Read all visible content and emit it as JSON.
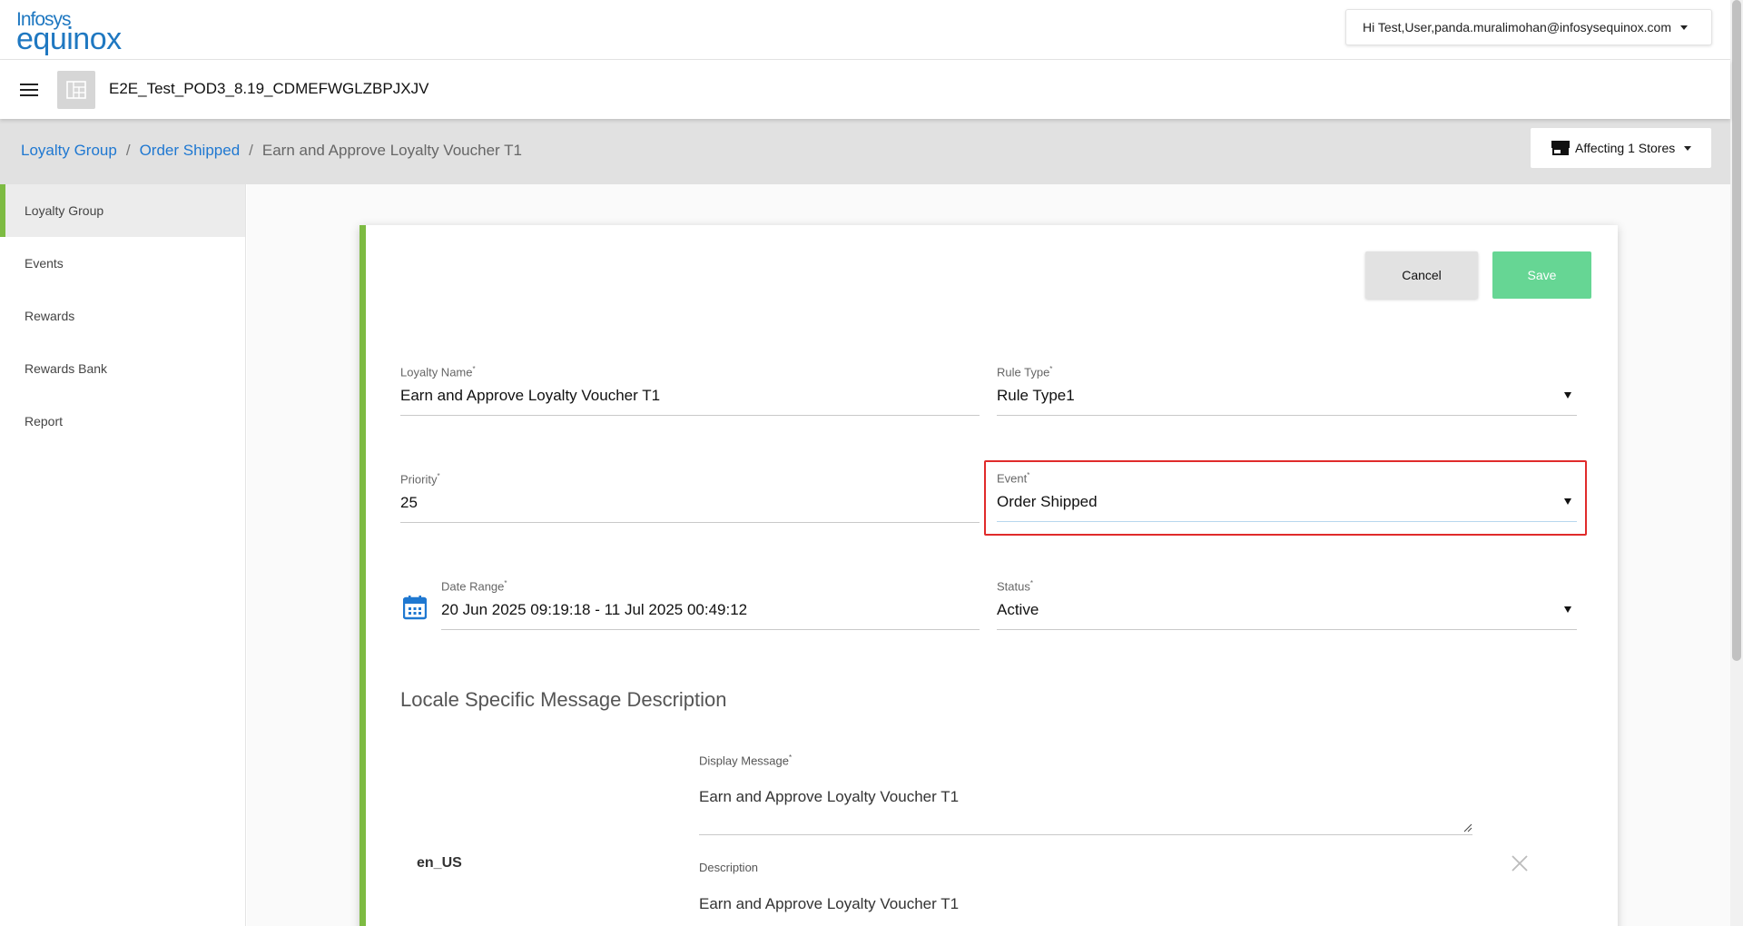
{
  "logo": {
    "line1": "Infosys",
    "line2": "equinox"
  },
  "user_menu": {
    "label": "Hi Test,User,panda.muralimohan@infosysequinox.com"
  },
  "store": {
    "name": "E2E_Test_POD3_8.19_CDMEFWGLZBPJXJV"
  },
  "breadcrumb": {
    "items": [
      "Loyalty Group",
      "Order Shipped"
    ],
    "separator": "/",
    "current": "Earn and Approve Loyalty Voucher T1"
  },
  "affecting": {
    "label": "Affecting 1 Stores"
  },
  "sidebar": {
    "items": [
      {
        "label": "Loyalty Group",
        "active": true
      },
      {
        "label": "Events"
      },
      {
        "label": "Rewards"
      },
      {
        "label": "Rewards Bank"
      },
      {
        "label": "Report"
      }
    ]
  },
  "actions": {
    "cancel": "Cancel",
    "save": "Save"
  },
  "form": {
    "loyalty_name": {
      "label": "Loyalty Name",
      "value": "Earn and Approve Loyalty Voucher T1"
    },
    "rule_type": {
      "label": "Rule Type",
      "value": "Rule Type1"
    },
    "priority": {
      "label": "Priority",
      "value": "25"
    },
    "event": {
      "label": "Event",
      "value": "Order Shipped"
    },
    "date_range": {
      "label": "Date Range",
      "value": "20 Jun 2025 09:19:18 - 11 Jul 2025 00:49:12"
    },
    "status": {
      "label": "Status",
      "value": "Active"
    },
    "required_mark": "*"
  },
  "locale_section": {
    "title": "Locale Specific Message Description",
    "locale": "en_US",
    "display_message": {
      "label": "Display Message",
      "value": "Earn and Approve Loyalty Voucher T1"
    },
    "description": {
      "label": "Description",
      "value": "Earn and Approve Loyalty Voucher T1"
    }
  },
  "colors": {
    "accent_green": "#7dbb42",
    "link_blue": "#1f78d1",
    "save_green": "#66d694",
    "highlight_red": "#e02b2b"
  }
}
